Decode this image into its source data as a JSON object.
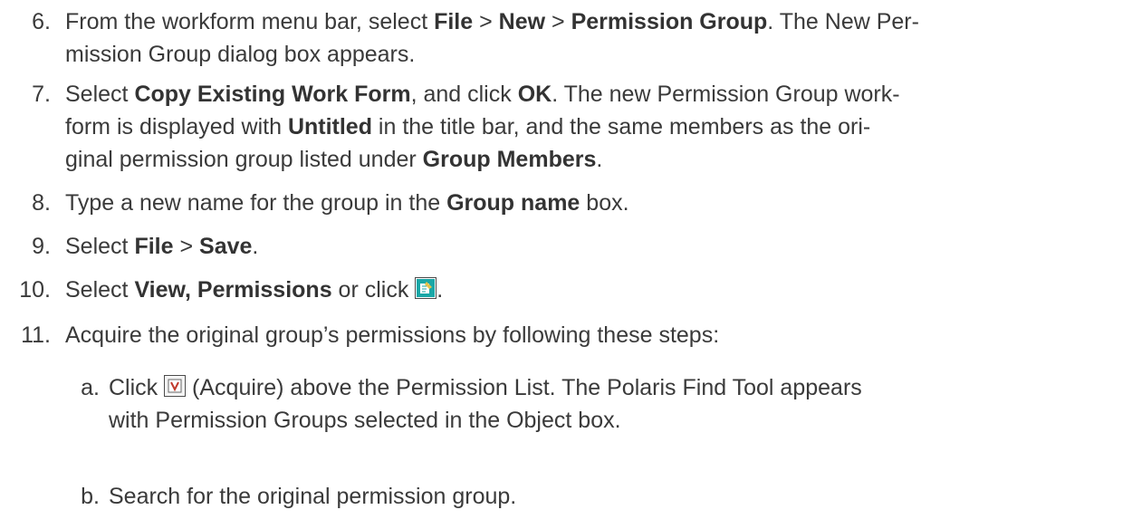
{
  "steps": [
    {
      "num": "6.",
      "lines": [
        [
          {
            "t": "From the workform menu bar, select "
          },
          {
            "b": "File"
          },
          {
            "t": " > "
          },
          {
            "b": "New"
          },
          {
            "t": " > "
          },
          {
            "b": "Permission Group"
          },
          {
            "t": ". The New Per-"
          }
        ],
        [
          {
            "t": "mission Group dialog box appears."
          }
        ]
      ]
    },
    {
      "num": "7.",
      "lines": [
        [
          {
            "t": "Select "
          },
          {
            "b": "Copy Existing Work Form"
          },
          {
            "t": ", and click "
          },
          {
            "b": "OK"
          },
          {
            "t": ". The new Permission Group work-"
          }
        ],
        [
          {
            "t": "form is displayed with "
          },
          {
            "b": "Untitled"
          },
          {
            "t": " in the title bar, and the same members as the ori-"
          }
        ],
        [
          {
            "t": "ginal permission group listed under "
          },
          {
            "b": "Group Members"
          },
          {
            "t": "."
          }
        ]
      ]
    },
    {
      "num": "8.",
      "lines": [
        [
          {
            "t": "Type a new name for the group in the "
          },
          {
            "b": "Group name"
          },
          {
            "t": " box."
          }
        ]
      ]
    },
    {
      "num": "9.",
      "lines": [
        [
          {
            "t": "Select "
          },
          {
            "b": "File"
          },
          {
            "t": " > "
          },
          {
            "b": "Save"
          },
          {
            "t": "."
          }
        ]
      ]
    },
    {
      "num": "10.",
      "lines": [
        [
          {
            "t": "Select "
          },
          {
            "b": "View, Permissions"
          },
          {
            "t": " or click "
          },
          {
            "icon": "permissions-icon"
          },
          {
            "t": "."
          }
        ]
      ]
    },
    {
      "num": "11.",
      "lines": [
        [
          {
            "t": "Acquire the original group’s permissions by following these steps:"
          }
        ]
      ]
    }
  ],
  "substeps": [
    {
      "num": "a.",
      "lines": [
        [
          {
            "t": "Click "
          },
          {
            "icon": "acquire-icon"
          },
          {
            "t": " (Acquire) above the Permission List. The Polaris Find Tool appears"
          }
        ],
        [
          {
            "t": "with Permission Groups selected in the Object box."
          }
        ]
      ]
    },
    {
      "num": "b.",
      "lines": [
        [
          {
            "t": "Search for the original permission group."
          }
        ]
      ]
    }
  ],
  "colors": {
    "text": "#3a3a3a",
    "icon_teal": "#1aa7a7",
    "icon_red": "#c0392b"
  }
}
